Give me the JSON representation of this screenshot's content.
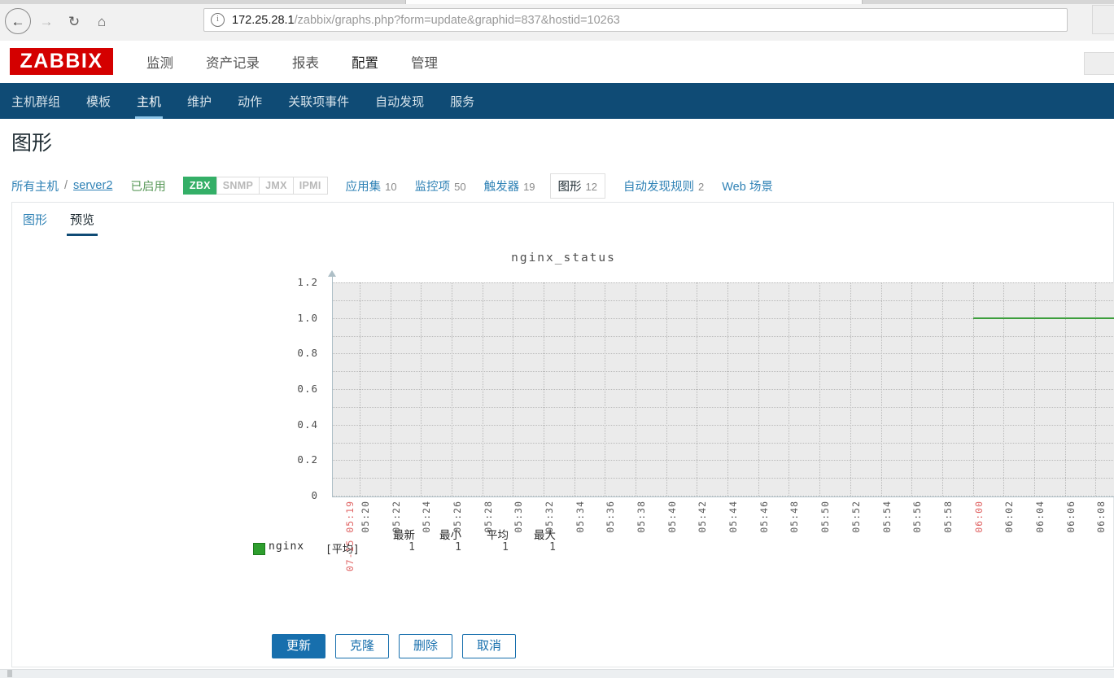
{
  "browser": {
    "back_icon": "back-arrow",
    "forward_icon": "forward-arrow",
    "reload_icon": "reload",
    "home_icon": "home",
    "url_host": "172.25.28.1",
    "url_path": "/zabbix/graphs.php?form=update&graphid=837&hostid=10263",
    "info_icon": "info-circle"
  },
  "header": {
    "logo": "ZABBIX",
    "menu": [
      {
        "label": "监测",
        "active": false
      },
      {
        "label": "资产记录",
        "active": false
      },
      {
        "label": "报表",
        "active": false
      },
      {
        "label": "配置",
        "active": true
      },
      {
        "label": "管理",
        "active": false
      }
    ]
  },
  "subnav": {
    "items": [
      {
        "label": "主机群组",
        "active": false
      },
      {
        "label": "模板",
        "active": false
      },
      {
        "label": "主机",
        "active": true
      },
      {
        "label": "维护",
        "active": false
      },
      {
        "label": "动作",
        "active": false
      },
      {
        "label": "关联项事件",
        "active": false
      },
      {
        "label": "自动发现",
        "active": false
      },
      {
        "label": "服务",
        "active": false
      }
    ]
  },
  "page": {
    "title": "图形"
  },
  "breadcrumb": {
    "all_hosts": "所有主机",
    "separator": "/",
    "host": "server2",
    "status": "已启用",
    "tags": [
      {
        "label": "ZBX",
        "enabled": true
      },
      {
        "label": "SNMP",
        "enabled": false
      },
      {
        "label": "JMX",
        "enabled": false
      },
      {
        "label": "IPMI",
        "enabled": false
      }
    ],
    "links": [
      {
        "label": "应用集",
        "count": "10",
        "selected": false
      },
      {
        "label": "监控项",
        "count": "50",
        "selected": false
      },
      {
        "label": "触发器",
        "count": "19",
        "selected": false
      },
      {
        "label": "图形",
        "count": "12",
        "selected": true
      },
      {
        "label": "自动发现规则",
        "count": "2",
        "selected": false
      },
      {
        "label": "Web 场景",
        "count": "",
        "selected": false
      }
    ]
  },
  "tabs": [
    {
      "label": "图形",
      "active": false
    },
    {
      "label": "预览",
      "active": true
    }
  ],
  "chart_data": {
    "type": "line",
    "title": "nginx_status",
    "xlabel": "",
    "ylabel": "",
    "ylim": [
      0,
      1.2
    ],
    "yticks": [
      "0",
      "0.2",
      "0.4",
      "0.6",
      "0.8",
      "1.0",
      "1.2"
    ],
    "grid": true,
    "legend_position": "bottom",
    "x_start_label": "07-15 05:19",
    "xticks": [
      "05:20",
      "05:22",
      "05:24",
      "05:26",
      "05:28",
      "05:30",
      "05:32",
      "05:34",
      "05:36",
      "05:38",
      "05:40",
      "05:42",
      "05:44",
      "05:46",
      "05:48",
      "05:50",
      "05:52",
      "05:54",
      "05:56",
      "05:58",
      "06:00",
      "06:02",
      "06:04",
      "06:06",
      "06:08"
    ],
    "highlight_xticks": [
      "07-15 05:19",
      "06:00"
    ],
    "series": [
      {
        "name": "nginx",
        "color": "#3c9e3c",
        "aggregation": "[平均]",
        "x_from": "06:00",
        "x_to": "06:08",
        "value": 1
      }
    ],
    "legend": {
      "columns": [
        "最新",
        "最小",
        "平均",
        "最大"
      ],
      "rows": [
        {
          "name": "nginx",
          "fn": "[平均]",
          "color": "#2e9e2e",
          "values": [
            "1",
            "1",
            "1",
            "1"
          ]
        }
      ]
    }
  },
  "buttons": [
    {
      "label": "更新",
      "style": "primary"
    },
    {
      "label": "克隆",
      "style": "ghost"
    },
    {
      "label": "删除",
      "style": "ghost"
    },
    {
      "label": "取消",
      "style": "ghost"
    }
  ]
}
